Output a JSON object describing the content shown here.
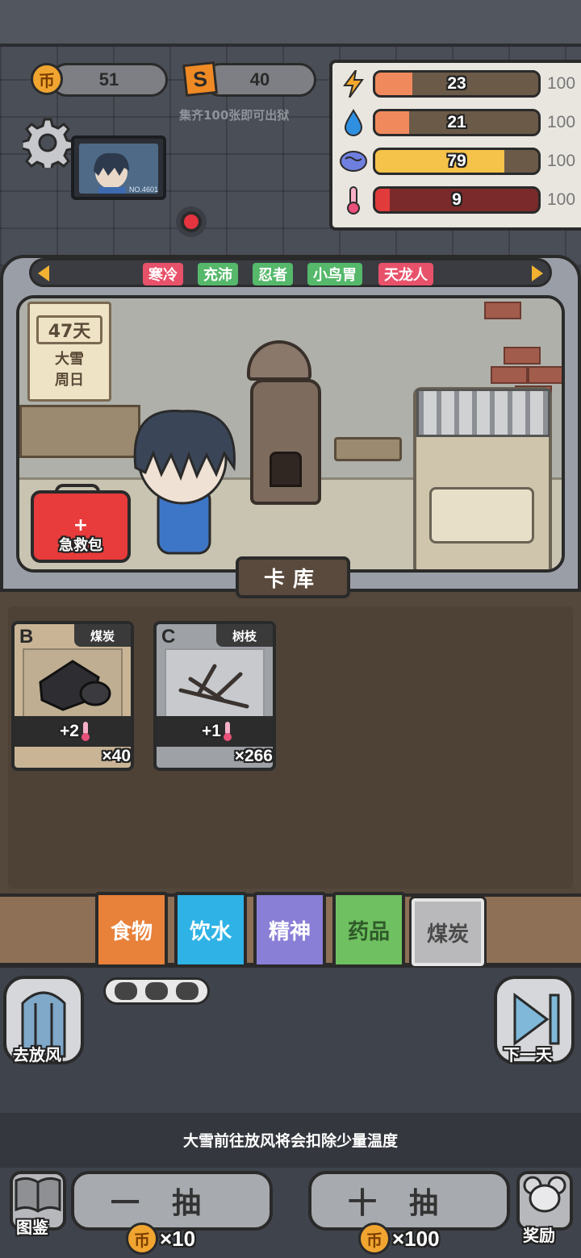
{
  "currency": {
    "coins": "51",
    "coin_icon": "币",
    "tickets": "40",
    "ticket_icon": "S",
    "hint": "集齐100张即可出狱"
  },
  "stats": [
    {
      "name": "energy",
      "icon": "lightning-icon",
      "value": "23",
      "max": "100",
      "fill": 0.23,
      "color": "#f08a5d"
    },
    {
      "name": "water",
      "icon": "water-drop-icon",
      "value": "21",
      "max": "100",
      "fill": 0.21,
      "color": "#f08a5d"
    },
    {
      "name": "spirit",
      "icon": "brain-icon",
      "value": "79",
      "max": "100",
      "fill": 0.79,
      "color": "#f5c24a"
    },
    {
      "name": "temperature",
      "icon": "thermometer-icon",
      "value": "9",
      "max": "100",
      "fill": 0.09,
      "color": "#e23b3b"
    }
  ],
  "monitor": {
    "label": "NO.4601"
  },
  "tags": [
    {
      "label": "寒冷",
      "color": "#e8516a"
    },
    {
      "label": "充沛",
      "color": "#55b86a"
    },
    {
      "label": "忍者",
      "color": "#55b86a"
    },
    {
      "label": "小鸟胃",
      "color": "#55b86a"
    },
    {
      "label": "天龙人",
      "color": "#e8516a"
    }
  ],
  "calendar": {
    "days": "47天",
    "weather": "大雪",
    "weekday": "周日"
  },
  "first_aid": {
    "cross": "+",
    "label": "急救包"
  },
  "card_library": {
    "title": "卡库"
  },
  "cards": [
    {
      "grade": "B",
      "name": "煤炭",
      "effect": "+2",
      "count": "×40",
      "bg": "#c9b596",
      "art_bg": "#bfae91"
    },
    {
      "grade": "C",
      "name": "树枝",
      "effect": "+1",
      "count": "×266",
      "bg": "#9ea1a6",
      "art_bg": "#c7c9cc"
    }
  ],
  "categories": [
    {
      "label": "食物",
      "bg": "#e8813a",
      "fg": "#fff",
      "selected": false
    },
    {
      "label": "饮水",
      "bg": "#2fb3e6",
      "fg": "#fff",
      "selected": false
    },
    {
      "label": "精神",
      "bg": "#8a7fd6",
      "fg": "#fff",
      "selected": false
    },
    {
      "label": "药品",
      "bg": "#6fc060",
      "fg": "#2f5a2a",
      "selected": false
    },
    {
      "label": "煤炭",
      "bg": "#b9b9bb",
      "fg": "#4a4a4a",
      "selected": true
    }
  ],
  "actions": {
    "go_outside": "去放风",
    "next_day": "下一天",
    "notice": "大雪前往放风将会扣除少量温度",
    "codex": "图鉴",
    "reward": "奖励",
    "draw_one": "一抽",
    "draw_one_cost": "×10",
    "draw_ten": "十抽",
    "draw_ten_cost": "×100"
  }
}
